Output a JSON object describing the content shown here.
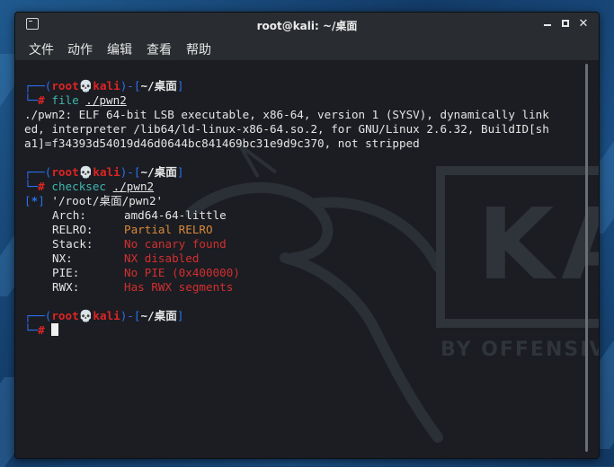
{
  "window": {
    "title": "root@kali: ~/桌面"
  },
  "menu": {
    "file": "文件",
    "action": "动作",
    "edit": "编辑",
    "view": "查看",
    "help": "帮助"
  },
  "prompt": {
    "top_open": "┌──(",
    "user": "root",
    "skull": "💀",
    "host": "kali",
    "mid": ")-[",
    "dir": "~/桌面",
    "close": "]",
    "bottom": "└─",
    "hash": "#"
  },
  "commands": {
    "c1_cmd": "file",
    "c1_arg": "./pwn2",
    "c2_cmd": "checksec",
    "c2_arg": "./pwn2"
  },
  "file_output": [
    "./pwn2: ELF 64-bit LSB executable, x86-64, version 1 (SYSV), dynamically link",
    "ed, interpreter /lib64/ld-linux-x86-64.so.2, for GNU/Linux 2.6.32, BuildID[sh",
    "a1]=f34393d54019d46d0644bc841469bc31e9d9c370, not stripped"
  ],
  "checksec": {
    "star": "*",
    "path": " '/root/桌面/pwn2'",
    "arch_key": "Arch:",
    "arch_val": "amd64-64-little",
    "relro_key": "RELRO:",
    "relro_val": "Partial RELRO",
    "stack_key": "Stack:",
    "stack_val": "No canary found",
    "nx_key": "NX:",
    "nx_val": "NX disabled",
    "pie_key": "PIE:",
    "pie_val": "No PIE (0x400000)",
    "rwx_key": "RWX:",
    "rwx_val": "Has RWX segments"
  },
  "colors": {
    "prompt_frame": "#2c6ff2",
    "prompt_user": "#e02424",
    "command": "#3fb6ae",
    "warn_orange": "#d98a3a",
    "danger_red": "#d32f2f",
    "background": "#1b1d22"
  },
  "watermark": {
    "text_big": "KA",
    "text_small": "BY OFFENSIVE"
  }
}
